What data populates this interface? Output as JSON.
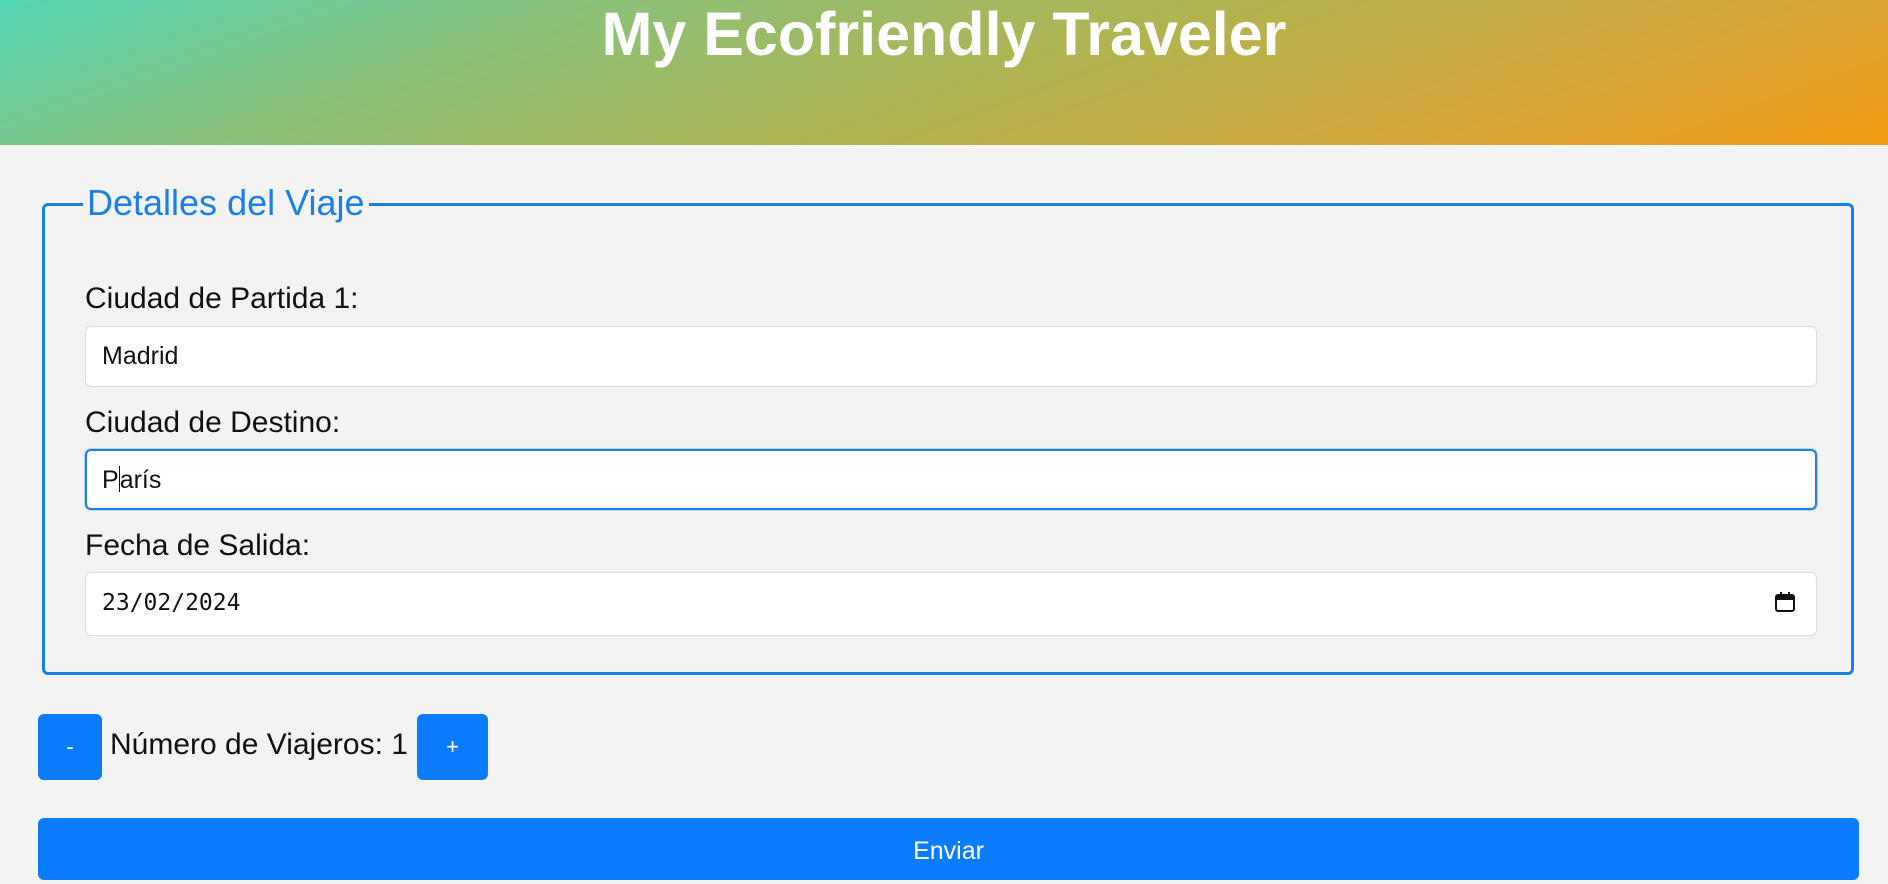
{
  "app": {
    "title": "My Ecofriendly Traveler"
  },
  "form": {
    "legend": "Detalles del Viaje",
    "origin": {
      "label": "Ciudad de Partida 1:",
      "value": "Madrid"
    },
    "destination": {
      "label": "Ciudad de Destino:",
      "value_before_caret": "P",
      "value_after_caret": "arís"
    },
    "departure_date": {
      "label": "Fecha de Salida:",
      "value": "23/02/2024"
    }
  },
  "travelers": {
    "decrement_label": "-",
    "count_text": "Número de Viajeros: 1",
    "increment_label": "+"
  },
  "submit": {
    "label": "Enviar"
  },
  "colors": {
    "accent": "#0a7cff",
    "fieldset_border": "#1a7fe6",
    "header_gradient_start": "#52d6b4",
    "header_gradient_end": "#f39c12"
  }
}
